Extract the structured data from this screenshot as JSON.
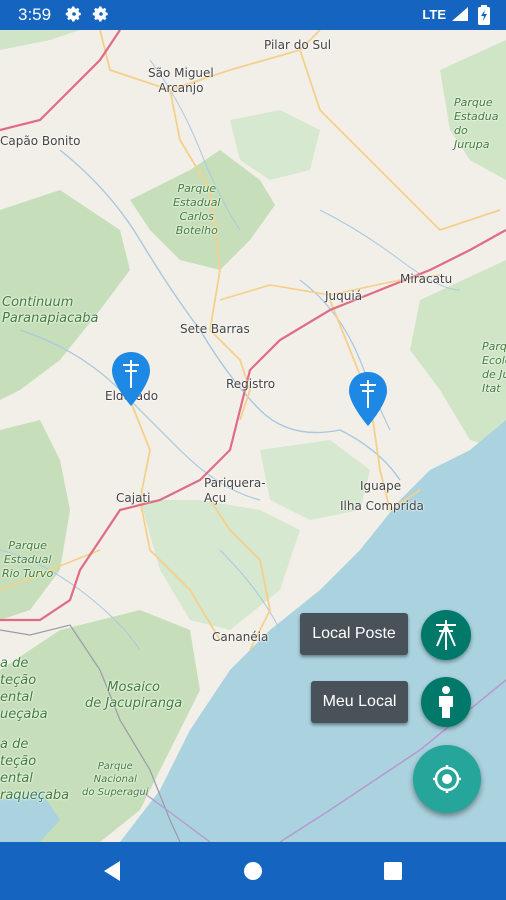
{
  "status_bar": {
    "time": "3:59",
    "network": "LTE",
    "icons": [
      "gear-icon",
      "gear-icon",
      "signal-icon",
      "battery-icon"
    ]
  },
  "map": {
    "place_labels": [
      {
        "text": "Pilar do Sul"
      },
      {
        "text": "São Miguel\nArcanjo"
      },
      {
        "text": "Capão Bonito"
      },
      {
        "text": "Miracatu"
      },
      {
        "text": "Juquiá"
      },
      {
        "text": "Sete Barras"
      },
      {
        "text": "Registro"
      },
      {
        "text": "Eldorado"
      },
      {
        "text": "Cajati"
      },
      {
        "text": "Pariquera-\nAçu"
      },
      {
        "text": "Iguape"
      },
      {
        "text": "Ilha Comprida"
      },
      {
        "text": "Cananéia"
      }
    ],
    "park_labels": [
      {
        "text": "Parque\nEstadual\nCarlos\nBotelho"
      },
      {
        "text": "Continuum\nParanapiacaba"
      },
      {
        "text": "Parque\nEstadual\nRio Turvo"
      },
      {
        "text": "Mosaico\nde Jacupiranga"
      },
      {
        "text": "Parque\nNacional\ndo Superagui"
      },
      {
        "text": "Parque\nEstadua\ndo Jurupa"
      },
      {
        "text": "Parq\nEcolo\nde Ju\nItat"
      },
      {
        "text": "a de\nteção\nental\nueçaba"
      },
      {
        "text": "a de\nteção\nental\nraqueçaba"
      }
    ],
    "markers": [
      {
        "name": "pole-marker-eldorado",
        "icon": "utility-pole-icon",
        "color": "#1e88e5"
      },
      {
        "name": "pole-marker-registro",
        "icon": "utility-pole-icon",
        "color": "#1e88e5"
      }
    ]
  },
  "fab_menu": {
    "local_poste_label": "Local Poste",
    "meu_local_label": "Meu Local",
    "colors": {
      "small": "#00796b",
      "main": "#26a69a",
      "label_bg": "#4a5259"
    }
  },
  "nav_bar": {
    "icons": [
      "back-icon",
      "home-icon",
      "recents-icon"
    ],
    "color": "#1565c0"
  }
}
